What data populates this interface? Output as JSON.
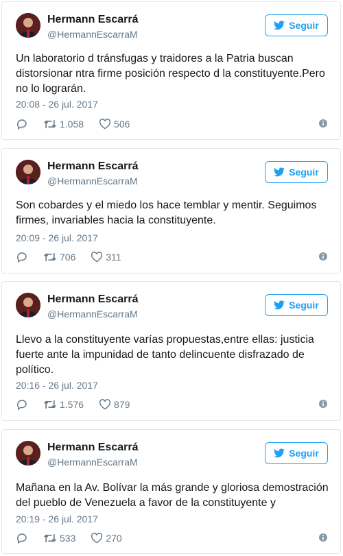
{
  "tweets": [
    {
      "name": "Hermann Escarrá",
      "handle": "@HermannEscarraM",
      "follow_label": "Seguir",
      "text": "Un laboratorio d tránsfugas y traidores a la Patria buscan distorsionar ntra firme posición respecto d la constituyente.Pero no lo lograrán.",
      "time": "20:08 - 26 jul. 2017",
      "retweets": "1.058",
      "likes": "506"
    },
    {
      "name": "Hermann Escarrá",
      "handle": "@HermannEscarraM",
      "follow_label": "Seguir",
      "text": "Son cobardes y el miedo los hace temblar y mentir. Seguimos firmes, invariables hacia la constituyente.",
      "time": "20:09 - 26 jul. 2017",
      "retweets": "706",
      "likes": "311"
    },
    {
      "name": "Hermann Escarrá",
      "handle": "@HermannEscarraM",
      "follow_label": "Seguir",
      "text": "Llevo a la constituyente varías propuestas,entre ellas: justicia fuerte ante la impunidad de tanto delincuente disfrazado de político.",
      "time": "20:16 - 26 jul. 2017",
      "retweets": "1.576",
      "likes": "879"
    },
    {
      "name": "Hermann Escarrá",
      "handle": "@HermannEscarraM",
      "follow_label": "Seguir",
      "text": "Mañana en la Av. Bolívar la más grande y gloriosa demostración del pueblo de Venezuela a favor de la constituyente y",
      "time": "20:19 - 26 jul. 2017",
      "retweets": "533",
      "likes": "270"
    }
  ],
  "colors": {
    "accent": "#1da1f2",
    "muted": "#657786",
    "border": "#e1e8ed"
  },
  "icons": [
    "bird-icon",
    "reply-icon",
    "retweet-icon",
    "heart-icon",
    "info-icon"
  ]
}
